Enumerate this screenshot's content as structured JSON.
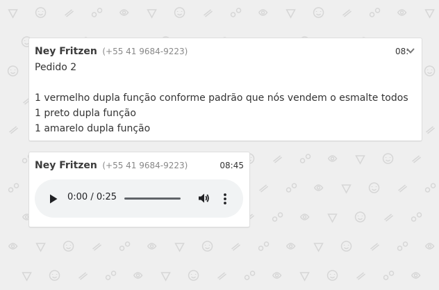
{
  "messages": [
    {
      "sender": "Ney Fritzen",
      "phone": "(+55 41 9684-9223)",
      "time": "08:45",
      "lines": [
        "Pedido 2",
        "",
        "1 vermelho dupla função conforme padrão que nós vendem o esmalte todos",
        "1 preto dupla função",
        "1 amarelo dupla função"
      ]
    },
    {
      "sender": "Ney Fritzen",
      "phone": "(+55 41 9684-9223)",
      "time": "08:45",
      "audio": {
        "time_display": "0:00 / 0:25",
        "progress": 0
      }
    }
  ],
  "icons": {
    "menu": "chevron-down-icon",
    "play": "play-icon",
    "volume": "volume-icon",
    "more": "more-vertical-icon"
  },
  "colors": {
    "background": "#efefef",
    "bubble": "#ffffff",
    "audio_player": "#f1f3f4"
  }
}
